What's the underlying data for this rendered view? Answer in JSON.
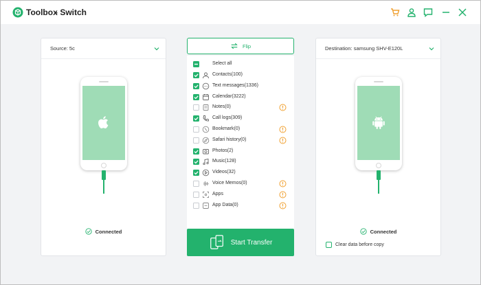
{
  "titlebar": {
    "app_name": "Toolbox",
    "app_sub": "- Switch",
    "icons": [
      "cart-icon",
      "user-icon",
      "feedback-icon",
      "minimize-icon",
      "close-icon"
    ]
  },
  "colors": {
    "accent": "#23b26d",
    "warning": "#f0a030",
    "screen": "#9fdcb6"
  },
  "source": {
    "label": "Source:  5c",
    "device_icon": "apple-logo-icon",
    "status": "Connected"
  },
  "destination": {
    "label": "Destination: samsung SHV-E120L",
    "device_icon": "android-logo-icon",
    "status": "Connected",
    "clear_data_label": "Clear data before copy",
    "clear_data_checked": false
  },
  "middle": {
    "flip_label": "Flip",
    "select_all_label": "Select all",
    "items": [
      {
        "label": "Contacts(100)",
        "checked": true,
        "icon": "contacts-icon",
        "warning": false
      },
      {
        "label": "Text messages(1336)",
        "checked": true,
        "icon": "message-icon",
        "warning": false
      },
      {
        "label": "Calendar(3222)",
        "checked": true,
        "icon": "calendar-icon",
        "warning": false
      },
      {
        "label": "Notes(0)",
        "checked": false,
        "icon": "notes-icon",
        "warning": true
      },
      {
        "label": "Call logs(309)",
        "checked": true,
        "icon": "phone-icon",
        "warning": false
      },
      {
        "label": "Bookmark(0)",
        "checked": false,
        "icon": "bookmark-icon",
        "warning": true
      },
      {
        "label": "Safari history(0)",
        "checked": false,
        "icon": "safari-icon",
        "warning": true
      },
      {
        "label": "Photos(2)",
        "checked": true,
        "icon": "photo-icon",
        "warning": false
      },
      {
        "label": "Music(128)",
        "checked": true,
        "icon": "music-icon",
        "warning": false
      },
      {
        "label": "Videos(32)",
        "checked": true,
        "icon": "video-icon",
        "warning": false
      },
      {
        "label": "Voice Memos(0)",
        "checked": false,
        "icon": "voice-memo-icon",
        "warning": true
      },
      {
        "label": "Apps",
        "checked": false,
        "icon": "apps-icon",
        "warning": true
      },
      {
        "label": "App Data(0)",
        "checked": false,
        "icon": "app-data-icon",
        "warning": true
      }
    ],
    "start_label": "Start Transfer"
  }
}
